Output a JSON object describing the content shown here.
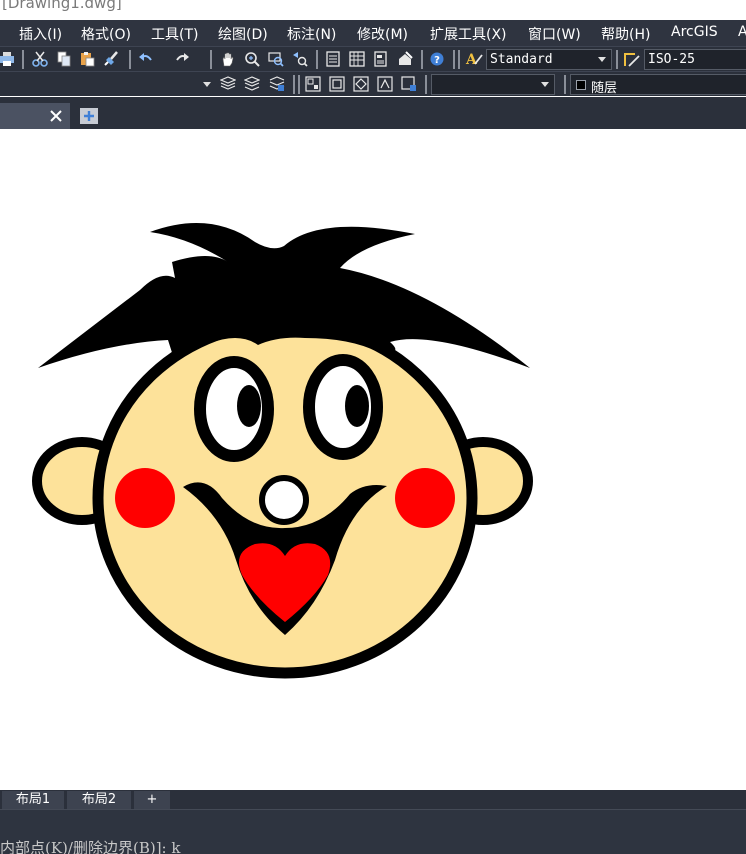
{
  "window": {
    "title": "[Drawing1.dwg]"
  },
  "menu": {
    "items": [
      "插入(I)",
      "格式(O)",
      "工具(T)",
      "绘图(D)",
      "标注(N)",
      "修改(M)",
      "扩展工具(X)",
      "窗口(W)",
      "帮助(H)",
      "ArcGIS",
      "A"
    ]
  },
  "toolbar": {
    "text_style": "Standard",
    "dim_style": "ISO-25",
    "layer_combo": "",
    "linetype_combo": "随层",
    "linetype_swatch_color": "#000000"
  },
  "tabs": {
    "drawing_tab_label": ""
  },
  "layouts": {
    "tabs": [
      "布局1",
      "布局2",
      "+"
    ]
  },
  "command": {
    "prompt": "内部点(K)/删除边界(B)]: k"
  },
  "drawing": {
    "colors": {
      "skin": "#fde29a",
      "outline": "#000000",
      "hair": "#000000",
      "cheek": "#ff0000",
      "tongue": "#ff0000",
      "eye_white": "#ffffff",
      "nose": "#ffffff"
    }
  },
  "icons": {
    "print": "printer-icon",
    "cut": "scissors-icon",
    "copy": "copy-icon",
    "paste": "paste-icon",
    "match": "brush-icon",
    "undo": "undo-icon",
    "redo": "redo-icon",
    "pan": "hand-icon",
    "zoom_realtime": "zoom-icon",
    "zoom_window": "zoom-window-icon",
    "zoom_prev": "zoom-previous-icon",
    "properties": "properties-icon",
    "design_center": "design-center-icon",
    "tool_palettes": "tool-palettes-icon",
    "markup": "markup-icon",
    "help": "help-icon",
    "text_style": "text-style-icon",
    "dim_style": "dim-style-icon",
    "close": "close-icon",
    "new_tab": "new-tab-icon"
  }
}
